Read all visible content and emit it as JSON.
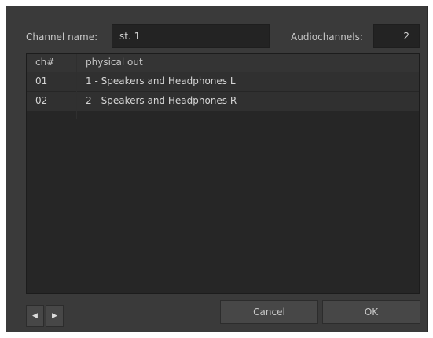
{
  "dialog": {
    "channel_name_label": "Channel name:",
    "channel_name_value": "st. 1",
    "audiochannels_label": "Audiochannels:",
    "audiochannels_value": "2"
  },
  "table": {
    "headers": [
      "ch#",
      "physical out"
    ],
    "rows": [
      {
        "ch": "01",
        "out": "1 - Speakers and Headphones L"
      },
      {
        "ch": "02",
        "out": "2 - Speakers and Headphones R"
      }
    ]
  },
  "footer": {
    "prev_icon": "triangle-left-icon",
    "next_icon": "triangle-right-icon",
    "prev_glyph": "◀",
    "next_glyph": "▶",
    "cancel_label": "Cancel",
    "ok_label": "OK"
  }
}
